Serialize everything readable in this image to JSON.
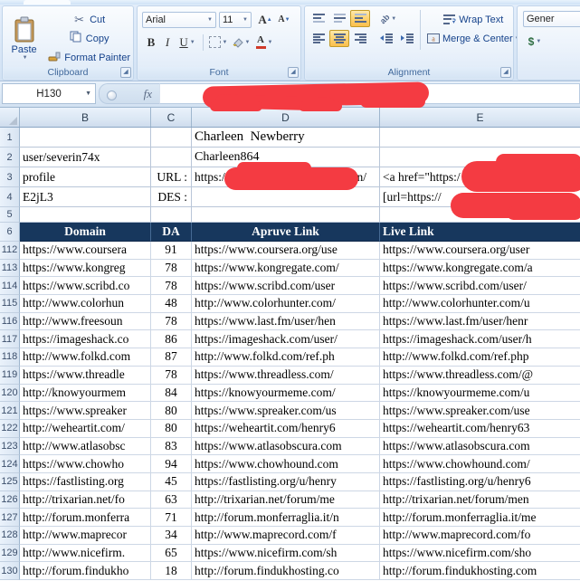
{
  "colors": {
    "header_navy": "#17375d",
    "redaction_red": "#f43b42",
    "active_toggle_orange": "#fcd578",
    "ribbon_label_blue": "#15428b"
  },
  "ribbon": {
    "clipboard": {
      "label": "Clipboard",
      "paste": "Paste",
      "cut": "Cut",
      "copy": "Copy",
      "format_painter": "Format Painter"
    },
    "font": {
      "label": "Font",
      "font_name": "Arial",
      "font_size": "11",
      "bold": "B",
      "italic": "I",
      "underline": "U"
    },
    "alignment": {
      "label": "Alignment",
      "wrap_text": "Wrap Text",
      "merge_center": "Merge & Center"
    },
    "number": {
      "format": "Gener",
      "currency": "$"
    }
  },
  "formula_bar": {
    "name_box": "H130",
    "fx_label": "fx"
  },
  "column_headers": [
    "B",
    "C",
    "D",
    "E"
  ],
  "info_rows": {
    "r1": {
      "num": "1",
      "d": "Charleen  Newberry"
    },
    "r2": {
      "num": "2",
      "b": "user/severin74x",
      "d": "Charleen864"
    },
    "r3": {
      "num": "3",
      "b": "profile",
      "c": "URL :",
      "d_prefix": "https://",
      "d_suffix": "n/",
      "e": "<a href=\"https:/"
    },
    "r4": {
      "num": "4",
      "b": "E2jL3",
      "c": "DES :",
      "e": "[url=https://"
    },
    "r5": {
      "num": "5"
    }
  },
  "table": {
    "header_num": "6",
    "headers": {
      "domain": "Domain",
      "da": "DA",
      "apruve": "Apruve Link",
      "live": "Live Link"
    },
    "rows": [
      {
        "num": "112",
        "domain": "https://www.coursera",
        "da": "91",
        "apruve": "https://www.coursera.org/use",
        "live": "https://www.coursera.org/user"
      },
      {
        "num": "113",
        "domain": "https://www.kongreg",
        "da": "78",
        "apruve": "https://www.kongregate.com/",
        "live": "https://www.kongregate.com/a"
      },
      {
        "num": "114",
        "domain": "https://www.scribd.co",
        "da": "78",
        "apruve": "https://www.scribd.com/user",
        "live": "https://www.scribd.com/user/"
      },
      {
        "num": "115",
        "domain": "http://www.colorhun",
        "da": "48",
        "apruve": "http://www.colorhunter.com/",
        "live": "http://www.colorhunter.com/u"
      },
      {
        "num": "116",
        "domain": "http://www.freesoun",
        "da": "78",
        "apruve": "https://www.last.fm/user/hen",
        "live": "https://www.last.fm/user/henr"
      },
      {
        "num": "117",
        "domain": "https://imageshack.co",
        "da": "86",
        "apruve": "https://imageshack.com/user/",
        "live": "https://imageshack.com/user/h"
      },
      {
        "num": "118",
        "domain": "http://www.folkd.com",
        "da": "87",
        "apruve": "http://www.folkd.com/ref.ph",
        "live": "http://www.folkd.com/ref.php"
      },
      {
        "num": "119",
        "domain": "https://www.threadle",
        "da": "78",
        "apruve": "https://www.threadless.com/",
        "live": "https://www.threadless.com/@"
      },
      {
        "num": "120",
        "domain": "http://knowyourmem",
        "da": "84",
        "apruve": "https://knowyourmeme.com/",
        "live": "https://knowyourmeme.com/u"
      },
      {
        "num": "121",
        "domain": "https://www.spreaker",
        "da": "80",
        "apruve": "https://www.spreaker.com/us",
        "live": "https://www.spreaker.com/use"
      },
      {
        "num": "122",
        "domain": "http://weheartit.com/",
        "da": "80",
        "apruve": "https://weheartit.com/henry6",
        "live": "https://weheartit.com/henry63"
      },
      {
        "num": "123",
        "domain": "http://www.atlasobsc",
        "da": "83",
        "apruve": "https://www.atlasobscura.com",
        "live": "https://www.atlasobscura.com"
      },
      {
        "num": "124",
        "domain": "https://www.chowho",
        "da": "94",
        "apruve": "https://www.chowhound.com",
        "live": "https://www.chowhound.com/"
      },
      {
        "num": "125",
        "domain": "https://fastlisting.org",
        "da": "45",
        "apruve": "https://fastlisting.org/u/henry",
        "live": "https://fastlisting.org/u/henry6"
      },
      {
        "num": "126",
        "domain": "http://trixarian.net/fo",
        "da": "63",
        "apruve": "http://trixarian.net/forum/me",
        "live": "http://trixarian.net/forum/men"
      },
      {
        "num": "127",
        "domain": "http://forum.monferra",
        "da": "71",
        "apruve": "http://forum.monferraglia.it/n",
        "live": "http://forum.monferraglia.it/me"
      },
      {
        "num": "128",
        "domain": "http://www.maprecor",
        "da": "34",
        "apruve": "http://www.maprecord.com/f",
        "live": "http://www.maprecord.com/fo"
      },
      {
        "num": "129",
        "domain": "http://www.nicefirm.",
        "da": "65",
        "apruve": "https://www.nicefirm.com/sh",
        "live": "https://www.nicefirm.com/sho"
      },
      {
        "num": "130",
        "domain": "http://forum.findukho",
        "da": "18",
        "apruve": "http://forum.findukhosting.co",
        "live": "http://forum.findukhosting.com"
      }
    ]
  }
}
